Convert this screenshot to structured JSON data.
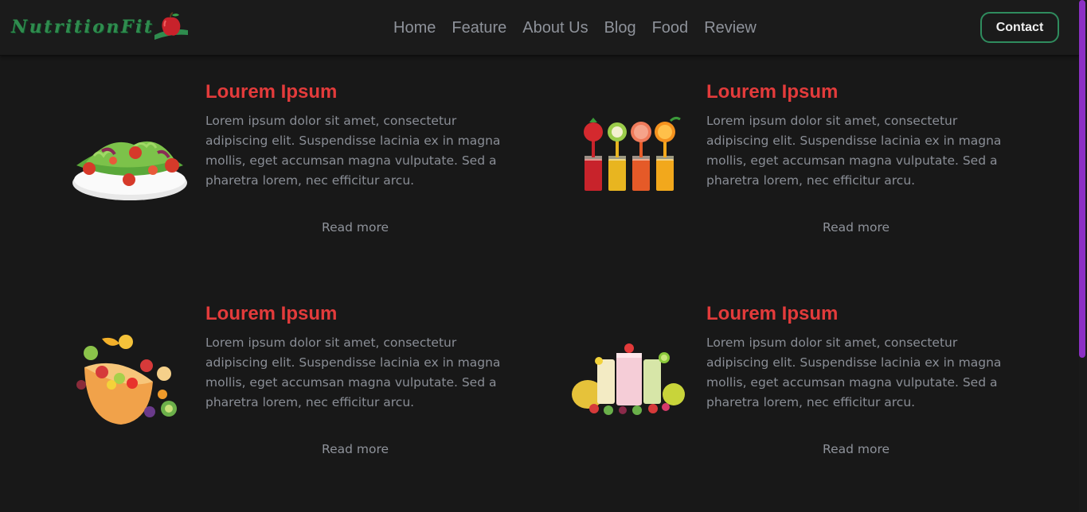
{
  "header": {
    "logo_text": "NutritionFit",
    "nav": [
      "Home",
      "Feature",
      "About Us",
      "Blog",
      "Food",
      "Review"
    ],
    "contact_label": "Contact"
  },
  "cards": [
    {
      "title": "Lourem Ipsum",
      "text": "Lorem ipsum dolor sit amet, consectetur adipiscing elit. Suspendisse lacinia ex in magna mollis, eget accumsan magna vulputate. Sed a pharetra lorem, nec efficitur arcu.",
      "link": "Read more",
      "image": "salad-bowl"
    },
    {
      "title": "Lourem Ipsum",
      "text": "Lorem ipsum dolor sit amet, consectetur adipiscing elit. Suspendisse lacinia ex in magna mollis, eget accumsan magna vulputate. Sed a pharetra lorem, nec efficitur arcu.",
      "link": "Read more",
      "image": "fruit-juice-glasses"
    },
    {
      "title": "Lourem Ipsum",
      "text": "Lorem ipsum dolor sit amet, consectetur adipiscing elit. Suspendisse lacinia ex in magna mollis, eget accumsan magna vulputate. Sed a pharetra lorem, nec efficitur arcu.",
      "link": "Read more",
      "image": "fruit-salad-bowl"
    },
    {
      "title": "Lourem Ipsum",
      "text": "Lorem ipsum dolor sit amet, consectetur adipiscing elit. Suspendisse lacinia ex in magna mollis, eget accumsan magna vulputate. Sed a pharetra lorem, nec efficitur arcu.",
      "link": "Read more",
      "image": "smoothie-glasses"
    }
  ],
  "colors": {
    "background": "#181818",
    "title_red": "#e33b3b",
    "brand_green": "#2f8c4e",
    "scrollbar": "#8b2fc4"
  }
}
